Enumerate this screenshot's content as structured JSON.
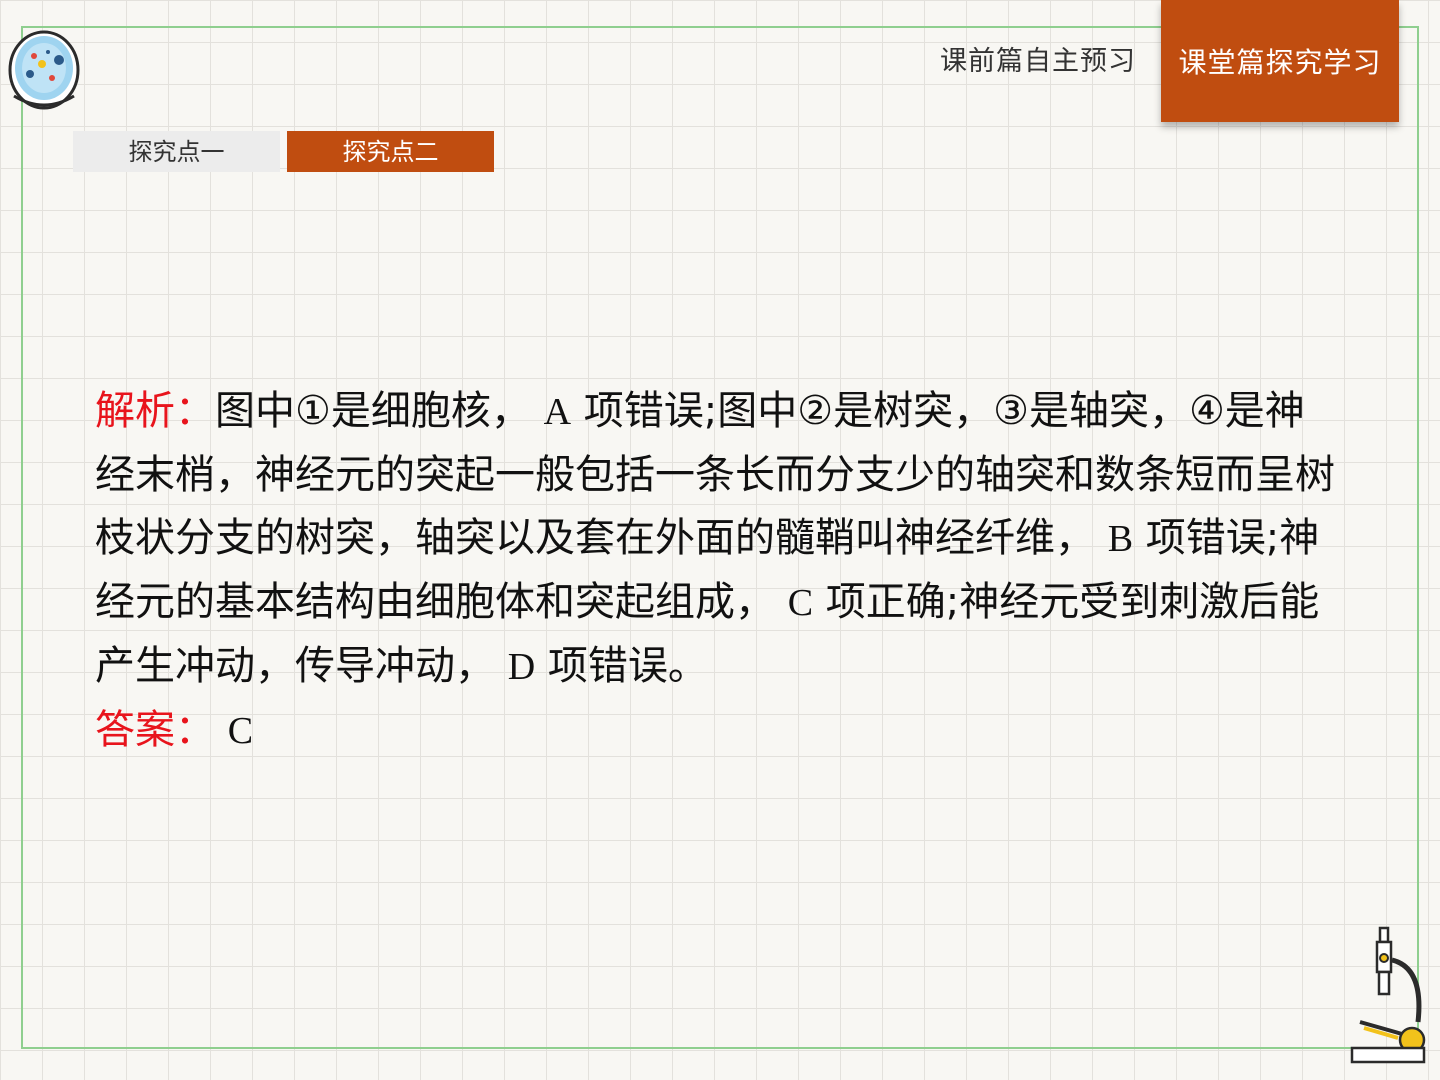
{
  "nav": {
    "prev_label": "课前篇自主预习",
    "current_label": "课堂篇探究学习"
  },
  "tabs": [
    {
      "label": "探究点一",
      "active": false
    },
    {
      "label": "探究点二",
      "active": true
    }
  ],
  "content": {
    "analysis_label": "解析：",
    "p1a": "图中①是细胞核，",
    "opt_a": "A",
    "p1b": "项错误;图中②是树突，③是轴突，④是神经末梢，神经元的突起一般包括一条长而分支少的轴突和数条短而呈树枝状分支的树突，轴突以及套在外面的髓鞘叫神经纤维，",
    "opt_b": "B",
    "p1c": "项错误;神经元的基本结构由细胞体和突起组成，",
    "opt_c": "C",
    "p1d": "项正确;神经元受到刺激后能产生冲动，传导冲动，",
    "opt_d": "D",
    "p1e": "项错误。",
    "answer_label": "答案：",
    "answer_value": "C"
  },
  "colors": {
    "accent": "#c04d10",
    "label_red": "#e8141c",
    "frame_green": "#8fcf8f",
    "grid": "#e3e1dc"
  },
  "icons": {
    "logo": "petri-dish-icon",
    "corner": "microscope-icon"
  }
}
